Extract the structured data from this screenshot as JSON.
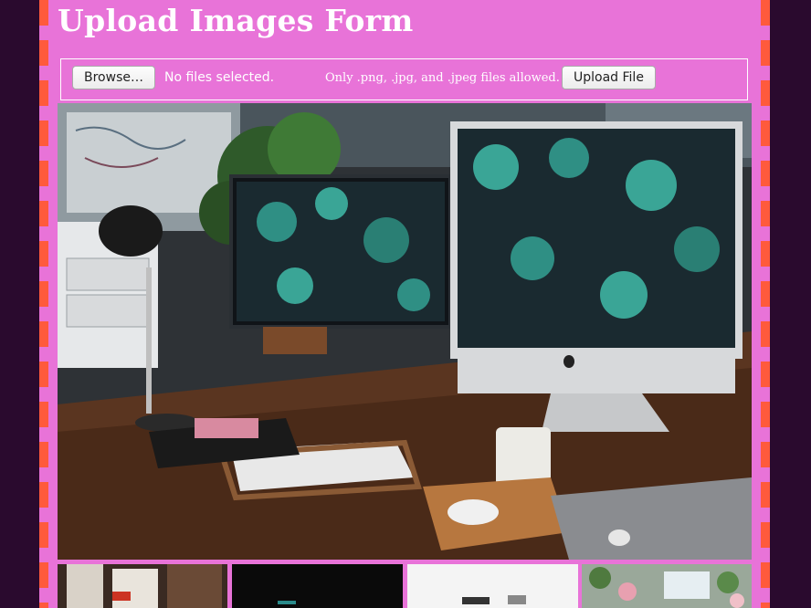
{
  "header": {
    "title": "Upload Images Form"
  },
  "upload_form": {
    "browse_label": "Browse…",
    "file_status": "No files selected.",
    "note": "Only .png, .jpg, and .jpeg files allowed.",
    "submit_label": "Upload File"
  },
  "colors": {
    "panel_bg": "#e873d8",
    "page_bg": "#2a0a2e",
    "dash_accent": "#ff5a3c"
  },
  "gallery": {
    "main_image": "desk-with-two-monitors",
    "thumbnails": [
      "office-interior",
      "dark-photo",
      "white-desk-photo",
      "flowers-table-photo"
    ]
  }
}
